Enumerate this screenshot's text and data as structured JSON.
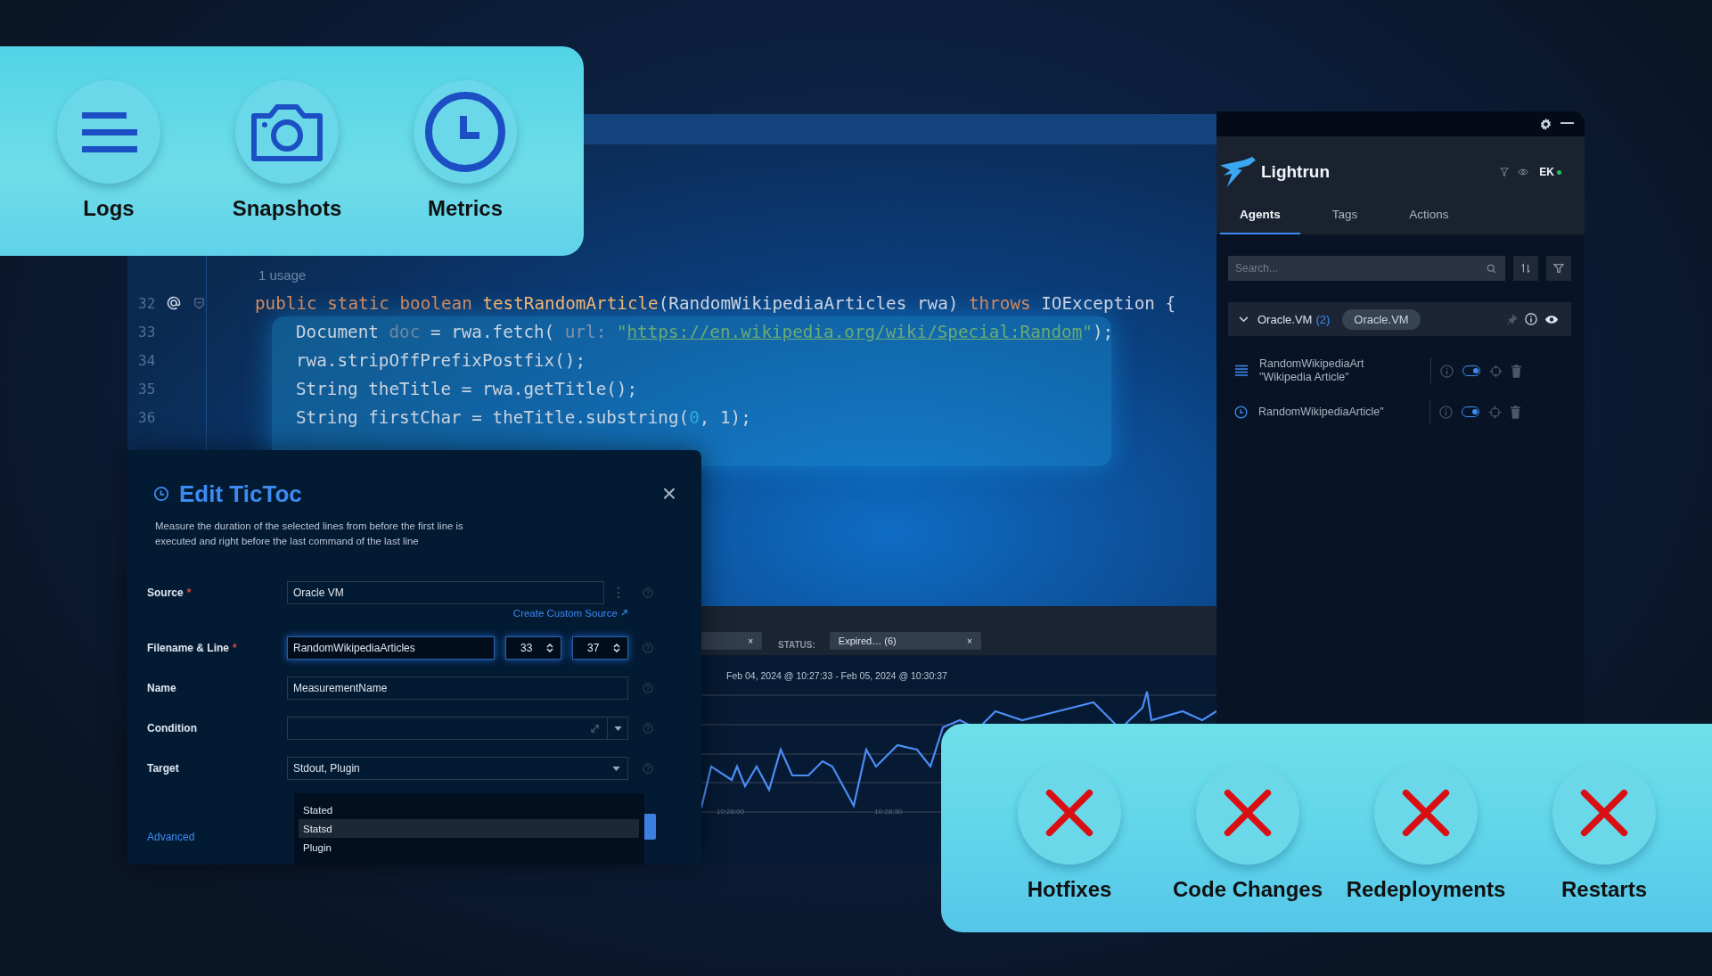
{
  "feature_card": {
    "items": [
      {
        "label": "Logs",
        "kind": "lines"
      },
      {
        "label": "Snapshots",
        "kind": "camera"
      },
      {
        "label": "Metrics",
        "kind": "clock"
      }
    ]
  },
  "editor": {
    "usage_hint": "1 usage",
    "lines": [
      {
        "number": "32",
        "annotated": true,
        "indented": false,
        "tokens": [
          {
            "kind": "keyword",
            "text": "public static boolean "
          },
          {
            "kind": "function",
            "text": "testRandomArticle"
          },
          {
            "kind": "plain",
            "text": "(RandomWikipediaArticles rwa) "
          },
          {
            "kind": "keyword",
            "text": "throws "
          },
          {
            "kind": "plain",
            "text": "IOException {"
          }
        ]
      },
      {
        "number": "33",
        "annotated": false,
        "indented": true,
        "tokens": [
          {
            "kind": "plain",
            "text": "Document "
          },
          {
            "kind": "muted",
            "text": "doc"
          },
          {
            "kind": "plain",
            "text": " = rwa.fetch( "
          },
          {
            "kind": "hint",
            "text": "url: "
          },
          {
            "kind": "string",
            "text": "\""
          },
          {
            "kind": "link",
            "text": "https://en.wikipedia.org/wiki/Special:Random"
          },
          {
            "kind": "string",
            "text": "\""
          },
          {
            "kind": "plain",
            "text": ");"
          }
        ]
      },
      {
        "number": "34",
        "annotated": false,
        "indented": true,
        "tokens": [
          {
            "kind": "plain",
            "text": "rwa.stripOffPrefixPostfix();"
          }
        ]
      },
      {
        "number": "35",
        "annotated": false,
        "indented": true,
        "tokens": [
          {
            "kind": "plain",
            "text": "String theTitle = rwa.getTitle();"
          }
        ]
      },
      {
        "number": "36",
        "annotated": false,
        "indented": true,
        "tokens": [
          {
            "kind": "plain",
            "text": "String firstChar = theTitle.substring("
          },
          {
            "kind": "number",
            "text": "0"
          },
          {
            "kind": "plain",
            "text": ", 1);"
          }
        ]
      }
    ]
  },
  "dialog": {
    "title": "Edit TicToc",
    "required_mark": "*",
    "description": "Measure the duration of the selected lines from before the first line is executed and right before the last command of the last line",
    "close": "×",
    "fields": [
      {
        "kind": "source",
        "label": "Source",
        "required": true,
        "value": "Oracle VM",
        "link": "Create Custom Source"
      },
      {
        "kind": "file",
        "label": "Filename & Line",
        "required": true,
        "value": "RandomWikipediaArticles",
        "line_from": "33",
        "line_to": "37"
      },
      {
        "kind": "text",
        "label": "Name",
        "required": false,
        "value": "MeasurementName"
      },
      {
        "kind": "condition",
        "label": "Condition",
        "required": false
      },
      {
        "kind": "select",
        "label": "Target",
        "required": false,
        "value": "Stdout, Plugin"
      }
    ],
    "options": [
      {
        "label": "Stated",
        "selected": false
      },
      {
        "label": "Statsd",
        "selected": true
      },
      {
        "label": "Plugin",
        "selected": false
      }
    ],
    "advanced": "Advanced"
  },
  "log_panel": {
    "filters": [
      {
        "kind": "chip",
        "close": "×"
      },
      {
        "kind": "label",
        "text": "STATUS:"
      },
      {
        "kind": "chip",
        "text": "Expired… (6)",
        "close": "×"
      }
    ],
    "range": "Feb 04, 2024 @ 10:27:33 - Feb 05, 2024 @ 10:30:37",
    "x_ticks": [
      "10:28:00",
      "10:28:30"
    ]
  },
  "lightrun": {
    "brand": "Lightrun",
    "user": "EK",
    "online": true,
    "tabs": [
      {
        "label": "Agents",
        "selected": true
      },
      {
        "label": "Tags",
        "selected": false
      },
      {
        "label": "Actions",
        "selected": false
      }
    ],
    "search": {
      "placeholder": "Search..."
    },
    "group": {
      "name": "Oracle.VM",
      "count": "(2)",
      "expanded": true,
      "tag": "Oracle.VM"
    },
    "actions": [
      {
        "kind": "log",
        "lines": [
          "RandomWikipediaArt",
          "\"Wikipedia Article\""
        ],
        "enabled": true
      },
      {
        "kind": "metric",
        "lines": [
          "RandomWikipediaArticle\""
        ],
        "enabled": true
      }
    ]
  },
  "benefits": {
    "items": [
      {
        "label": "Hotfixes"
      },
      {
        "label": "Code Changes"
      },
      {
        "label": "Redeployments"
      },
      {
        "label": "Restarts"
      }
    ]
  }
}
